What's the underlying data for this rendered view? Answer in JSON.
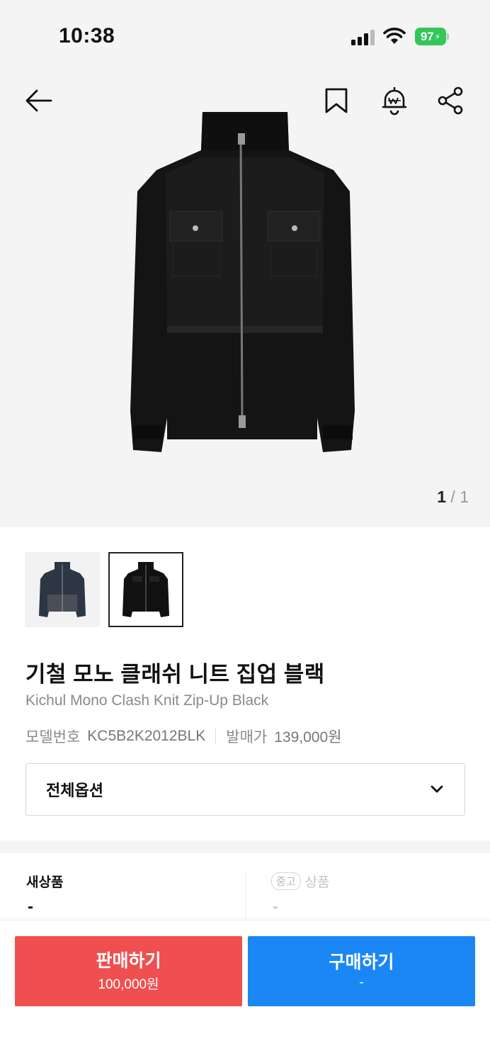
{
  "status": {
    "time": "10:38",
    "battery": "97"
  },
  "hero": {
    "pager_current": "1",
    "pager_sep": " / ",
    "pager_total": "1"
  },
  "product": {
    "name_ko": "기철 모노 클래쉬 니트 집업 블랙",
    "name_en": "Kichul Mono Clash Knit Zip-Up Black",
    "model_label": "모델번호",
    "model_value": "KC5B2K2012BLK",
    "release_label": "발매가",
    "release_value": "139,000원"
  },
  "option": {
    "label": "전체옵션"
  },
  "tabs": {
    "new_label": "새상품",
    "used_badge": "중고",
    "used_label": "상품",
    "new_price": "-",
    "used_price": "-"
  },
  "actions": {
    "sell_label": "판매하기",
    "sell_price": "100,000원",
    "buy_label": "구매하기",
    "buy_price": "-"
  },
  "colors": {
    "sell": "#ef4f4f",
    "buy": "#1a87f5",
    "battery": "#33c759"
  },
  "icons": [
    "back-arrow-icon",
    "bookmark-icon",
    "price-alert-bell-icon",
    "share-icon",
    "chevron-down-icon"
  ]
}
